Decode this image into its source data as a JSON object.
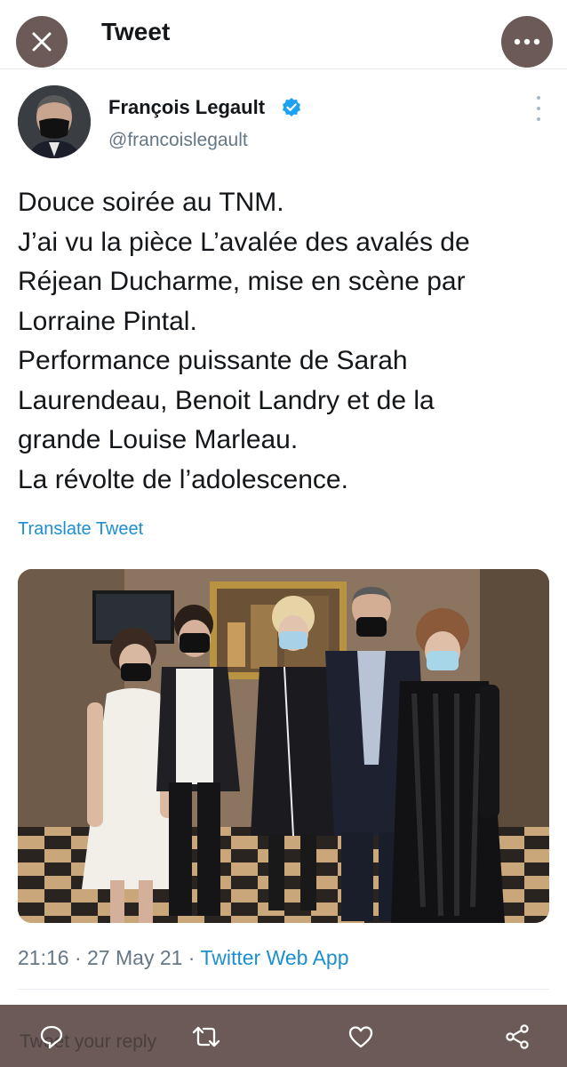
{
  "header": {
    "title": "Tweet",
    "close_icon": "close-icon",
    "more_icon": "more-horizontal-icon"
  },
  "author": {
    "name": "François Legault",
    "handle": "@francoislegault",
    "verified": true
  },
  "tweet": {
    "lines": [
      "Douce soirée au TNM.",
      "J’ai vu la pièce L’avalée des avalés de",
      "Réjean Ducharme, mise en scène par",
      "Lorraine Pintal.",
      "Performance puissante de Sarah",
      "Laurendeau, Benoit Landry et de la",
      "grande Louise Marleau.",
      "La révolte de l’adolescence."
    ],
    "translate_label": "Translate Tweet"
  },
  "meta": {
    "time": "21:16",
    "separator": " · ",
    "date": "27 May 21",
    "source": "Twitter Web App"
  },
  "reply_bar": {
    "placeholder": "Tweet your reply",
    "icons": [
      "reply-icon",
      "retweet-icon",
      "like-icon",
      "share-icon"
    ]
  },
  "colors": {
    "accent": "#1d8fcf",
    "verified": "#1da1f2",
    "overlay_button": "#6b5a57",
    "secondary_text": "#657786"
  }
}
